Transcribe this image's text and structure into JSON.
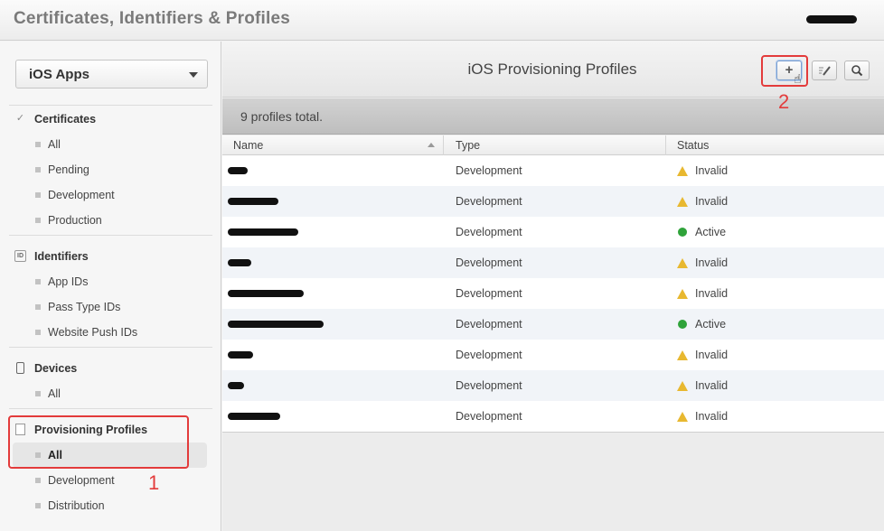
{
  "app": {
    "title": "Certificates, Identifiers & Profiles"
  },
  "sidebar": {
    "platform_select": {
      "value": "iOS Apps"
    },
    "sections": [
      {
        "title": "Certificates",
        "icon": "certificate-icon",
        "items": [
          "All",
          "Pending",
          "Development",
          "Production"
        ]
      },
      {
        "title": "Identifiers",
        "icon": "id-icon",
        "icon_text": "ID",
        "items": [
          "App IDs",
          "Pass Type IDs",
          "Website Push IDs"
        ]
      },
      {
        "title": "Devices",
        "icon": "device-icon",
        "items": [
          "All"
        ]
      },
      {
        "title": "Provisioning Profiles",
        "icon": "document-icon",
        "items": [
          "All",
          "Development",
          "Distribution"
        ],
        "selected_item": "All"
      }
    ]
  },
  "annotations": {
    "marker1": "1",
    "marker2": "2"
  },
  "main": {
    "title": "iOS Provisioning Profiles",
    "toolbar": {
      "add_icon": "+",
      "edit_icon": "pencil-icon",
      "search_icon": "magnifier-icon"
    },
    "count_text": "9 profiles total.",
    "table": {
      "columns": [
        "Name",
        "Type",
        "Status"
      ],
      "rows": [
        {
          "type": "Development",
          "status": "Invalid"
        },
        {
          "type": "Development",
          "status": "Invalid"
        },
        {
          "type": "Development",
          "status": "Active"
        },
        {
          "type": "Development",
          "status": "Invalid"
        },
        {
          "type": "Development",
          "status": "Invalid"
        },
        {
          "type": "Development",
          "status": "Active"
        },
        {
          "type": "Development",
          "status": "Invalid"
        },
        {
          "type": "Development",
          "status": "Invalid"
        },
        {
          "type": "Development",
          "status": "Invalid"
        }
      ]
    }
  },
  "colors": {
    "annotation_red": "#e33b3b",
    "active_green": "#2fa33a",
    "warning_yellow": "#e8b830"
  }
}
